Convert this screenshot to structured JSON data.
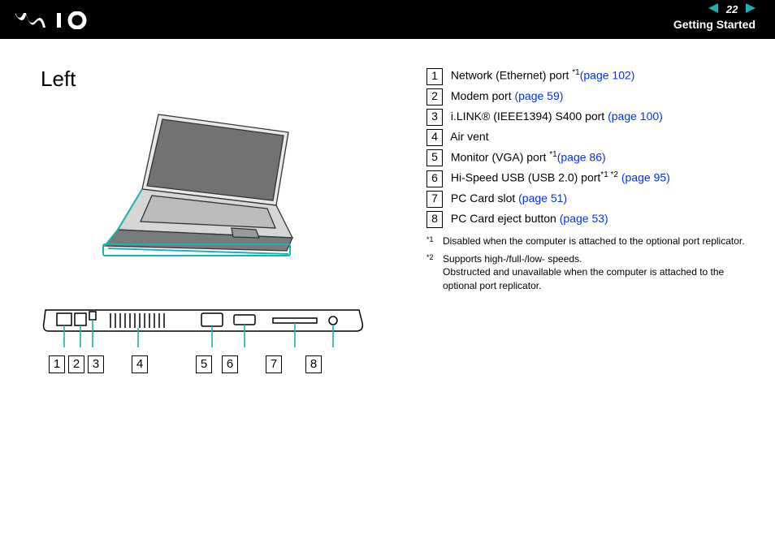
{
  "hdr": {
    "logo": "\\/\\10",
    "page": "22",
    "section": "Getting Started"
  },
  "title": "Left",
  "items": [
    {
      "n": "1",
      "text": "Network (Ethernet) port ",
      "sup": "*1",
      "link": "(page 102)"
    },
    {
      "n": "2",
      "text": "Modem port ",
      "sup": "",
      "link": "(page 59)"
    },
    {
      "n": "3",
      "text": "i.LINK® (IEEE1394) S400 port ",
      "sup": "",
      "link": "(page 100)"
    },
    {
      "n": "4",
      "text": "Air vent",
      "sup": "",
      "link": ""
    },
    {
      "n": "5",
      "text": "Monitor (VGA) port ",
      "sup": "*1",
      "link": "(page 86)"
    },
    {
      "n": "6",
      "text": "Hi-Speed USB (USB 2.0) port",
      "sup": "*1 *2",
      "link": " (page 95)"
    },
    {
      "n": "7",
      "text": "PC Card slot ",
      "sup": "",
      "link": "(page 51)"
    },
    {
      "n": "8",
      "text": "PC Card eject button ",
      "sup": "",
      "link": "(page 53)"
    }
  ],
  "notes": [
    {
      "sup": "*1",
      "text": "Disabled when the computer is attached to the optional port replicator."
    },
    {
      "sup": "*2",
      "text": "Supports high-/full-/low- speeds.\nObstructed and unavailable when the computer is attached to the optional port replicator."
    }
  ],
  "callouts": [
    "1",
    "2",
    "3",
    "4",
    "5",
    "6",
    "7",
    "8"
  ],
  "callout_gaps": [
    0,
    0,
    0,
    30,
    55,
    8,
    30,
    25
  ]
}
